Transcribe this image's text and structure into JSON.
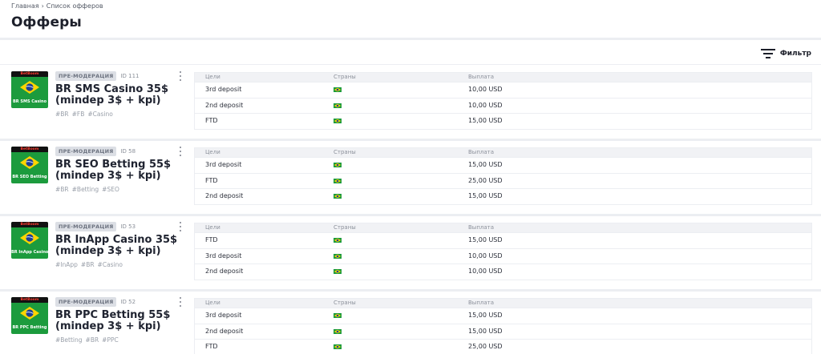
{
  "breadcrumb": {
    "home": "Главная",
    "current": "Список офферов"
  },
  "page_title": "Офферы",
  "filter_label": "Фильтр",
  "table_headers": {
    "goals": "Цели",
    "countries": "Страны",
    "payout": "Выплата"
  },
  "colors": {
    "thumb_green": "#1c9b3d",
    "flag_yellow": "#ffd500",
    "flag_blue": "#1d3f95",
    "badge_bg": "#dcdfe5"
  },
  "offers": [
    {
      "status": "ПРЕ-МОДЕРАЦИЯ",
      "id": "ID 111",
      "title": "BR SMS Casino 35$ (mindep 3$ + kpi)",
      "thumb": {
        "brand": "BetBoom",
        "caption": "BR SMS Casino"
      },
      "tags": [
        "#BR",
        "#FB",
        "#Casino"
      ],
      "rows": [
        {
          "goal": "3rd deposit",
          "country_icon": "brazil-flag-icon",
          "payout": "10,00 USD"
        },
        {
          "goal": "2nd deposit",
          "country_icon": "brazil-flag-icon",
          "payout": "10,00 USD"
        },
        {
          "goal": "FTD",
          "country_icon": "brazil-flag-icon",
          "payout": "15,00 USD"
        }
      ]
    },
    {
      "status": "ПРЕ-МОДЕРАЦИЯ",
      "id": "ID 58",
      "title": "BR SEO Betting 55$ (mindep 3$ + kpi)",
      "thumb": {
        "brand": "BetBoom",
        "caption": "BR SEO Betting"
      },
      "tags": [
        "#BR",
        "#Betting",
        "#SEO"
      ],
      "rows": [
        {
          "goal": "3rd deposit",
          "country_icon": "brazil-flag-icon",
          "payout": "15,00 USD"
        },
        {
          "goal": "FTD",
          "country_icon": "brazil-flag-icon",
          "payout": "25,00 USD"
        },
        {
          "goal": "2nd deposit",
          "country_icon": "brazil-flag-icon",
          "payout": "15,00 USD"
        }
      ]
    },
    {
      "status": "ПРЕ-МОДЕРАЦИЯ",
      "id": "ID 53",
      "title": "BR InApp Casino 35$ (mindep 3$ + kpi)",
      "thumb": {
        "brand": "BetBoom",
        "caption": "BR InApp Casino"
      },
      "tags": [
        "#InApp",
        "#BR",
        "#Casino"
      ],
      "rows": [
        {
          "goal": "FTD",
          "country_icon": "brazil-flag-icon",
          "payout": "15,00 USD"
        },
        {
          "goal": "3rd deposit",
          "country_icon": "brazil-flag-icon",
          "payout": "10,00 USD"
        },
        {
          "goal": "2nd deposit",
          "country_icon": "brazil-flag-icon",
          "payout": "10,00 USD"
        }
      ]
    },
    {
      "status": "ПРЕ-МОДЕРАЦИЯ",
      "id": "ID 52",
      "title": "BR PPC Betting 55$ (mindep 3$ + kpi)",
      "thumb": {
        "brand": "BetBoom",
        "caption": "BR PPC Betting"
      },
      "tags": [
        "#Betting",
        "#BR",
        "#PPC"
      ],
      "rows": [
        {
          "goal": "3rd deposit",
          "country_icon": "brazil-flag-icon",
          "payout": "15,00 USD"
        },
        {
          "goal": "2nd deposit",
          "country_icon": "brazil-flag-icon",
          "payout": "15,00 USD"
        },
        {
          "goal": "FTD",
          "country_icon": "brazil-flag-icon",
          "payout": "25,00 USD"
        }
      ]
    }
  ]
}
